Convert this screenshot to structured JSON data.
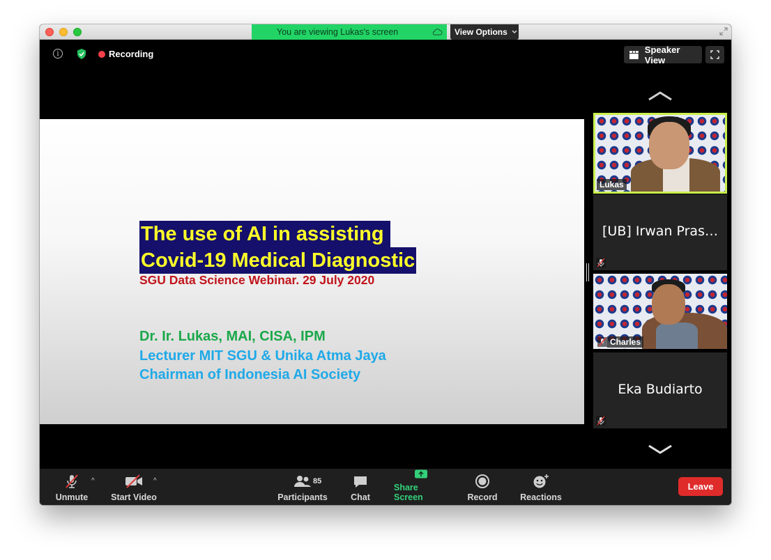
{
  "window": {
    "banner_text": "You are viewing Lukas's screen",
    "view_options_label": "View Options",
    "recording_label": "Recording",
    "speaker_view_label": "Speaker View"
  },
  "slide": {
    "title_line1": "The use of AI in assisting",
    "title_line2": "Covid-19 Medical Diagnostic",
    "subtitle": "SGU Data Science Webinar. 29 July 2020",
    "author": "Dr. Ir. Lukas, MAI, CISA, IPM",
    "line1": "Lecturer MIT SGU & Unika Atma Jaya",
    "line2": "Chairman of Indonesia AI Society",
    "colors": {
      "title_bg": "#14106b",
      "title_fg": "#ffff2a",
      "subtitle": "#c0151c",
      "author": "#1aa84a",
      "lines": "#1fa9e8"
    }
  },
  "participants_panel": {
    "tiles": [
      {
        "name": "Lukas",
        "type": "video",
        "active_speaker": true
      },
      {
        "name": "[UB] Irwan Pras…",
        "type": "name-only",
        "muted": true
      },
      {
        "name": "Charles",
        "type": "video",
        "muted": true
      },
      {
        "name": "Eka Budiarto",
        "type": "name-only",
        "muted": true
      }
    ]
  },
  "toolbar": {
    "unmute_label": "Unmute",
    "start_video_label": "Start Video",
    "participants_label": "Participants",
    "participants_count": "85",
    "chat_label": "Chat",
    "share_screen_label": "Share Screen",
    "record_label": "Record",
    "reactions_label": "Reactions",
    "leave_label": "Leave"
  },
  "icons": {
    "info": "info-icon",
    "security": "shield-icon",
    "mic_muted": "mic-muted-icon",
    "video_off": "video-off-icon",
    "participants": "people-icon",
    "chat": "chat-bubble-icon",
    "share": "share-arrow-icon",
    "record": "record-icon",
    "reactions": "emoji-plus-icon"
  }
}
